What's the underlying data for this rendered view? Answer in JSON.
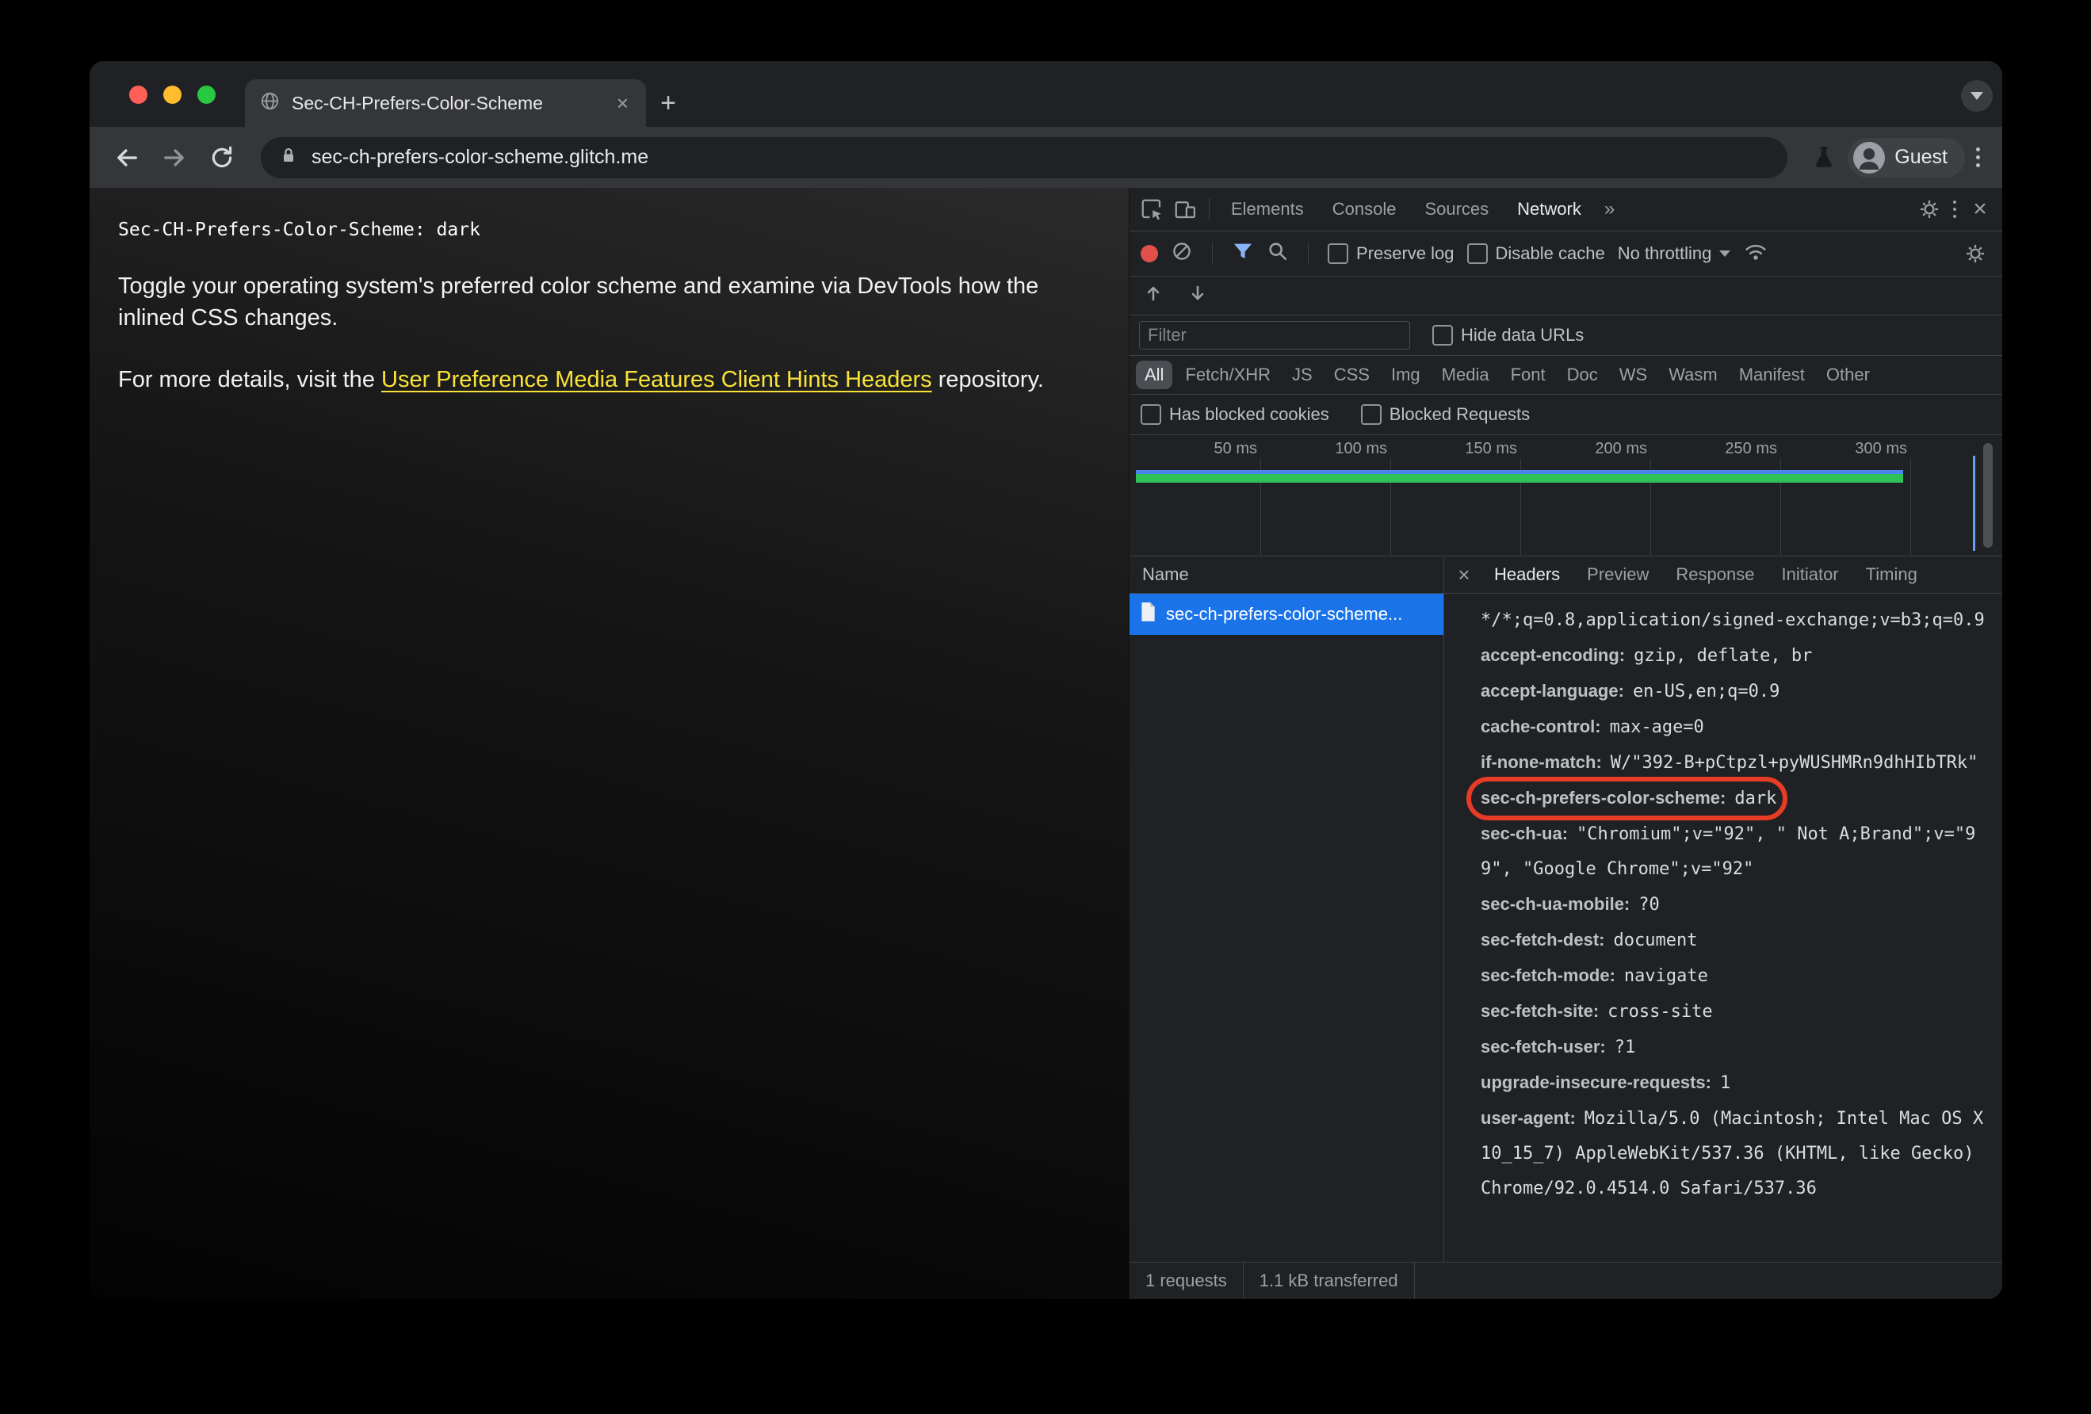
{
  "icons": {
    "close": "×",
    "new_tab": "+",
    "more_tabs": "»"
  },
  "browser": {
    "tab_title": "Sec-CH-Prefers-Color-Scheme",
    "url": "sec-ch-prefers-color-scheme.glitch.me",
    "profile_label": "Guest"
  },
  "page": {
    "header_line": "Sec-CH-Prefers-Color-Scheme: dark",
    "paragraph1": "Toggle your operating system's preferred color scheme and examine via DevTools how the inlined CSS changes.",
    "paragraph2_prefix": "For more details, visit the ",
    "paragraph2_link": "User Preference Media Features Client Hints Headers",
    "paragraph2_suffix": " repository."
  },
  "devtools": {
    "main_tabs": [
      "Elements",
      "Console",
      "Sources",
      "Network"
    ],
    "toolbar": {
      "preserve_log": "Preserve log",
      "disable_cache": "Disable cache",
      "throttling": "No throttling"
    },
    "filter_placeholder": "Filter",
    "hide_data_urls": "Hide data URLs",
    "chips": [
      "All",
      "Fetch/XHR",
      "JS",
      "CSS",
      "Img",
      "Media",
      "Font",
      "Doc",
      "WS",
      "Wasm",
      "Manifest",
      "Other"
    ],
    "blocked_checkboxes": [
      "Has blocked cookies",
      "Blocked Requests"
    ],
    "timeline_labels": [
      "50 ms",
      "100 ms",
      "150 ms",
      "200 ms",
      "250 ms",
      "300 ms"
    ],
    "requests_header": "Name",
    "request_row": "sec-ch-prefers-color-scheme...",
    "detail_tabs": [
      "Headers",
      "Preview",
      "Response",
      "Initiator",
      "Timing"
    ],
    "headers": [
      {
        "name": "",
        "value": "*/*;q=0.8,application/signed-exchange;v=b3;q=0.9"
      },
      {
        "name": "accept-encoding:",
        "value": "gzip, deflate, br"
      },
      {
        "name": "accept-language:",
        "value": "en-US,en;q=0.9"
      },
      {
        "name": "cache-control:",
        "value": "max-age=0"
      },
      {
        "name": "if-none-match:",
        "value": "W/\"392-B+pCtpzl+pyWUSHMRn9dhHIbTRk\""
      },
      {
        "name": "sec-ch-prefers-color-scheme:",
        "value": "dark"
      },
      {
        "name": "sec-ch-ua:",
        "value": "\"Chromium\";v=\"92\", \" Not A;Brand\";v=\"99\", \"Google Chrome\";v=\"92\""
      },
      {
        "name": "sec-ch-ua-mobile:",
        "value": "?0"
      },
      {
        "name": "sec-fetch-dest:",
        "value": "document"
      },
      {
        "name": "sec-fetch-mode:",
        "value": "navigate"
      },
      {
        "name": "sec-fetch-site:",
        "value": "cross-site"
      },
      {
        "name": "sec-fetch-user:",
        "value": "?1"
      },
      {
        "name": "upgrade-insecure-requests:",
        "value": "1"
      },
      {
        "name": "user-agent:",
        "value": "Mozilla/5.0 (Macintosh; Intel Mac OS X 10_15_7) AppleWebKit/537.36 (KHTML, like Gecko) Chrome/92.0.4514.0 Safari/537.36"
      }
    ],
    "status": {
      "requests": "1 requests",
      "transferred": "1.1 kB transferred"
    }
  },
  "colors": {
    "accent_blue": "#1a73e8",
    "link_yellow": "#fae339",
    "annotation_red": "#e83b26",
    "waterfall_green": "#2ec258"
  }
}
